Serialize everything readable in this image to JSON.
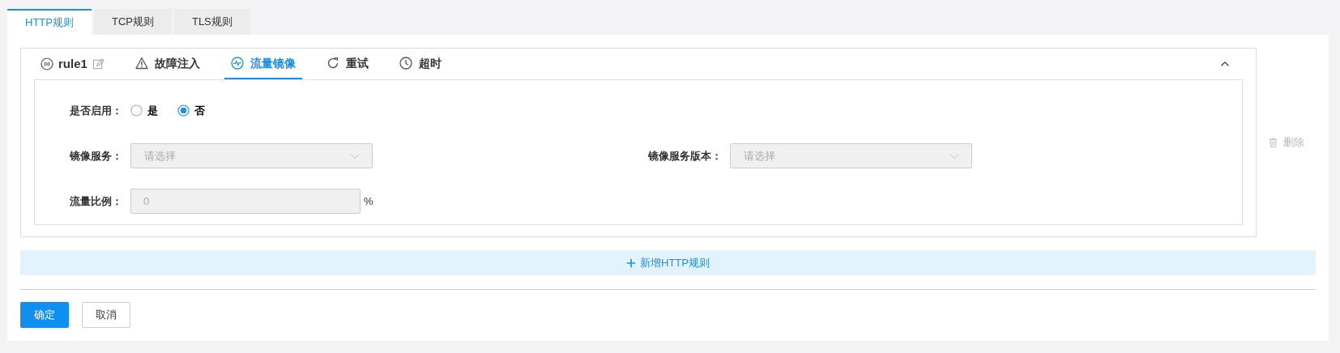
{
  "top_tabs": [
    {
      "label": "HTTP规则",
      "selected": true
    },
    {
      "label": "TCP规则",
      "selected": false
    },
    {
      "label": "TLS规则",
      "selected": false
    }
  ],
  "rule": {
    "name": "rule1",
    "expanded": true,
    "tabs": [
      {
        "kind": "fault",
        "label": "故障注入",
        "selected": false
      },
      {
        "kind": "mirror",
        "label": "流量镜像",
        "selected": true
      },
      {
        "kind": "retry",
        "label": "重试",
        "selected": false
      },
      {
        "kind": "timeout",
        "label": "超时",
        "selected": false
      }
    ],
    "form": {
      "enable": {
        "label": "是否启用：",
        "options": [
          {
            "label": "是",
            "selected": false
          },
          {
            "label": "否",
            "selected": true
          }
        ]
      },
      "mirror_service": {
        "label": "镜像服务：",
        "placeholder": "请选择",
        "disabled": true
      },
      "mirror_version": {
        "label": "镜像服务版本：",
        "placeholder": "请选择",
        "disabled": true
      },
      "traffic_ratio": {
        "label": "流量比例：",
        "value": "0",
        "unit": "%",
        "disabled": true
      }
    },
    "delete": {
      "label": "删除",
      "disabled": true
    }
  },
  "add_rule": {
    "label": "新增HTTP规则"
  },
  "buttons": [
    {
      "kind": "primary",
      "label": "确定"
    },
    {
      "kind": "secondary",
      "label": "取消"
    }
  ]
}
